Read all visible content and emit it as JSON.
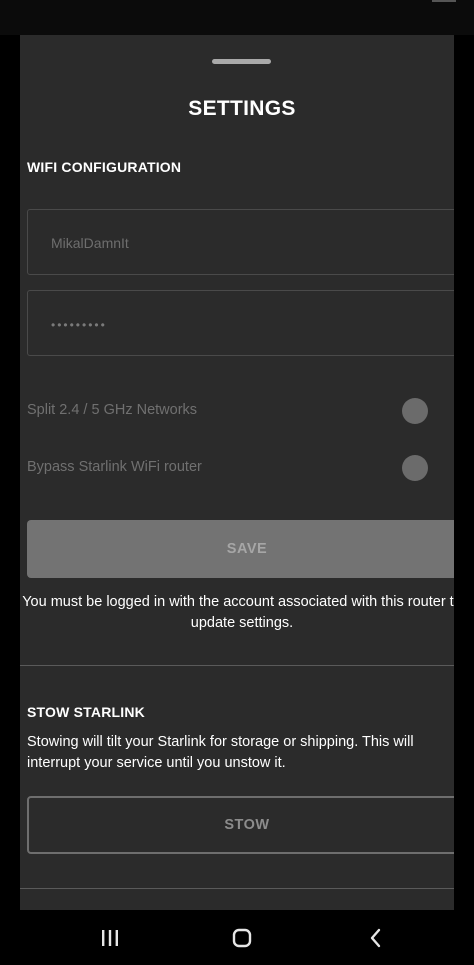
{
  "sheet": {
    "title": "SETTINGS"
  },
  "wifi": {
    "section_title": "WIFI CONFIGURATION",
    "network_name_value": "MikalDamnIt",
    "password_value": "•••••••••",
    "split_networks_label": "Split 2.4 / 5 GHz Networks",
    "split_networks_on": false,
    "bypass_router_label": "Bypass Starlink WiFi router",
    "bypass_router_on": false,
    "save_label": "SAVE",
    "login_note": "You must be logged in with the account associated with this router to update settings."
  },
  "stow": {
    "section_title": "STOW STARLINK",
    "description": "Stowing will tilt your Starlink for storage or shipping. This will interrupt your service until you unstow it.",
    "button_label": "STOW"
  },
  "nav": {
    "recents_icon": "recents-icon",
    "home_icon": "home-icon",
    "back_icon": "back-icon"
  },
  "colors": {
    "sheet_background": "#2b2b2b",
    "save_button_disabled": "#737373",
    "toggle_off": "#6b6b6b"
  }
}
